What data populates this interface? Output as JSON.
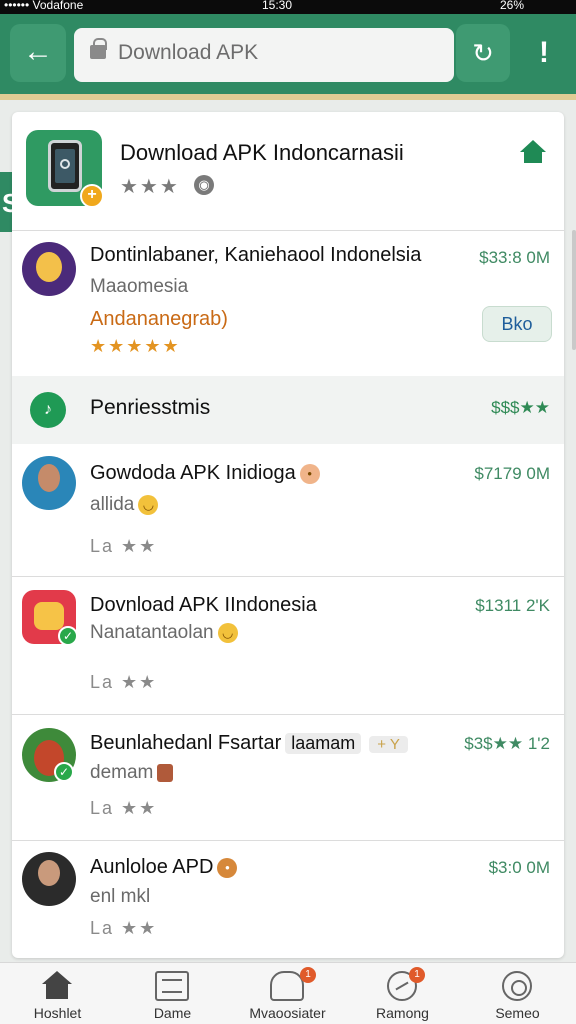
{
  "status_bar": {
    "carrier": "•••••• Vodafone",
    "time": "15:30",
    "battery": "26%"
  },
  "search": {
    "placeholder": "Download APK"
  },
  "left_strip_letter": "S",
  "main_app": {
    "title": "Download APK Indoncarnasii",
    "rating_stars": "★★★",
    "globe_glyph": "◉"
  },
  "icons": {
    "back": "←",
    "refresh": "↻",
    "alert": "!"
  },
  "featured": {
    "title": "Dontinlabaner, Kaniehaool Indonelsia",
    "subtitle": "Maaomesia",
    "tag": "Andananegrab)",
    "stars": "★★★★★",
    "price": "$33:8 0M",
    "button_label": "Bko"
  },
  "section": {
    "title": "Penriesstmis",
    "price": "$$$★★",
    "icon_glyph": "♪"
  },
  "list_items": [
    {
      "title": "Gowdoda APK Inidioga",
      "subtitle": "allida",
      "meta": "La ★★",
      "price": "$7179 0M"
    },
    {
      "title": "Dovnload APK IIndonesia",
      "subtitle": "Nanatantaolan",
      "meta": "La ★★",
      "price": "$1311 2'K"
    },
    {
      "title": "Beunlahedanl Fsartar",
      "chip": "laamam",
      "chip2": "+ Y",
      "subtitle": "demam",
      "meta": "La ★★",
      "price": "$3$★★ 1'2"
    },
    {
      "title": "Aunloloe APD",
      "subtitle": "enl mkl",
      "meta": "La ★★",
      "price": "$3:0 0M"
    }
  ],
  "bottom_nav": [
    {
      "label": "Hoshlet",
      "icon": "home-icon"
    },
    {
      "label": "Dame",
      "icon": "list-icon"
    },
    {
      "label": "Mvaoosiater",
      "icon": "bell-icon",
      "badge": "1"
    },
    {
      "label": "Ramong",
      "icon": "dial-icon",
      "badge": "1"
    },
    {
      "label": "Semeo",
      "icon": "swirl-icon"
    }
  ],
  "colors": {
    "primary_green": "#2f8a63",
    "price_green": "#3f8a63",
    "accent_orange": "#e39422"
  }
}
